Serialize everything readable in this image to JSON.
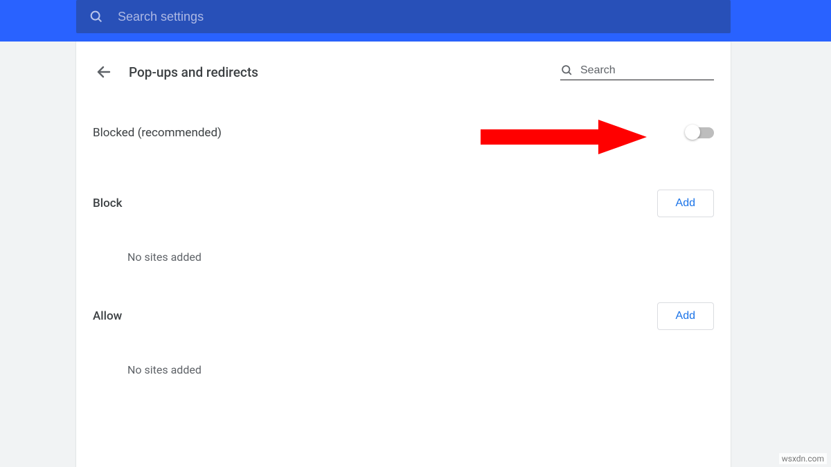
{
  "topSearch": {
    "placeholder": "Search settings"
  },
  "page": {
    "title": "Pop-ups and redirects"
  },
  "inlineSearch": {
    "placeholder": "Search"
  },
  "toggle": {
    "label": "Blocked (recommended)",
    "state": "off"
  },
  "sections": {
    "block": {
      "title": "Block",
      "add": "Add",
      "empty": "No sites added"
    },
    "allow": {
      "title": "Allow",
      "add": "Add",
      "empty": "No sites added"
    }
  },
  "watermark": "wsxdn.com"
}
